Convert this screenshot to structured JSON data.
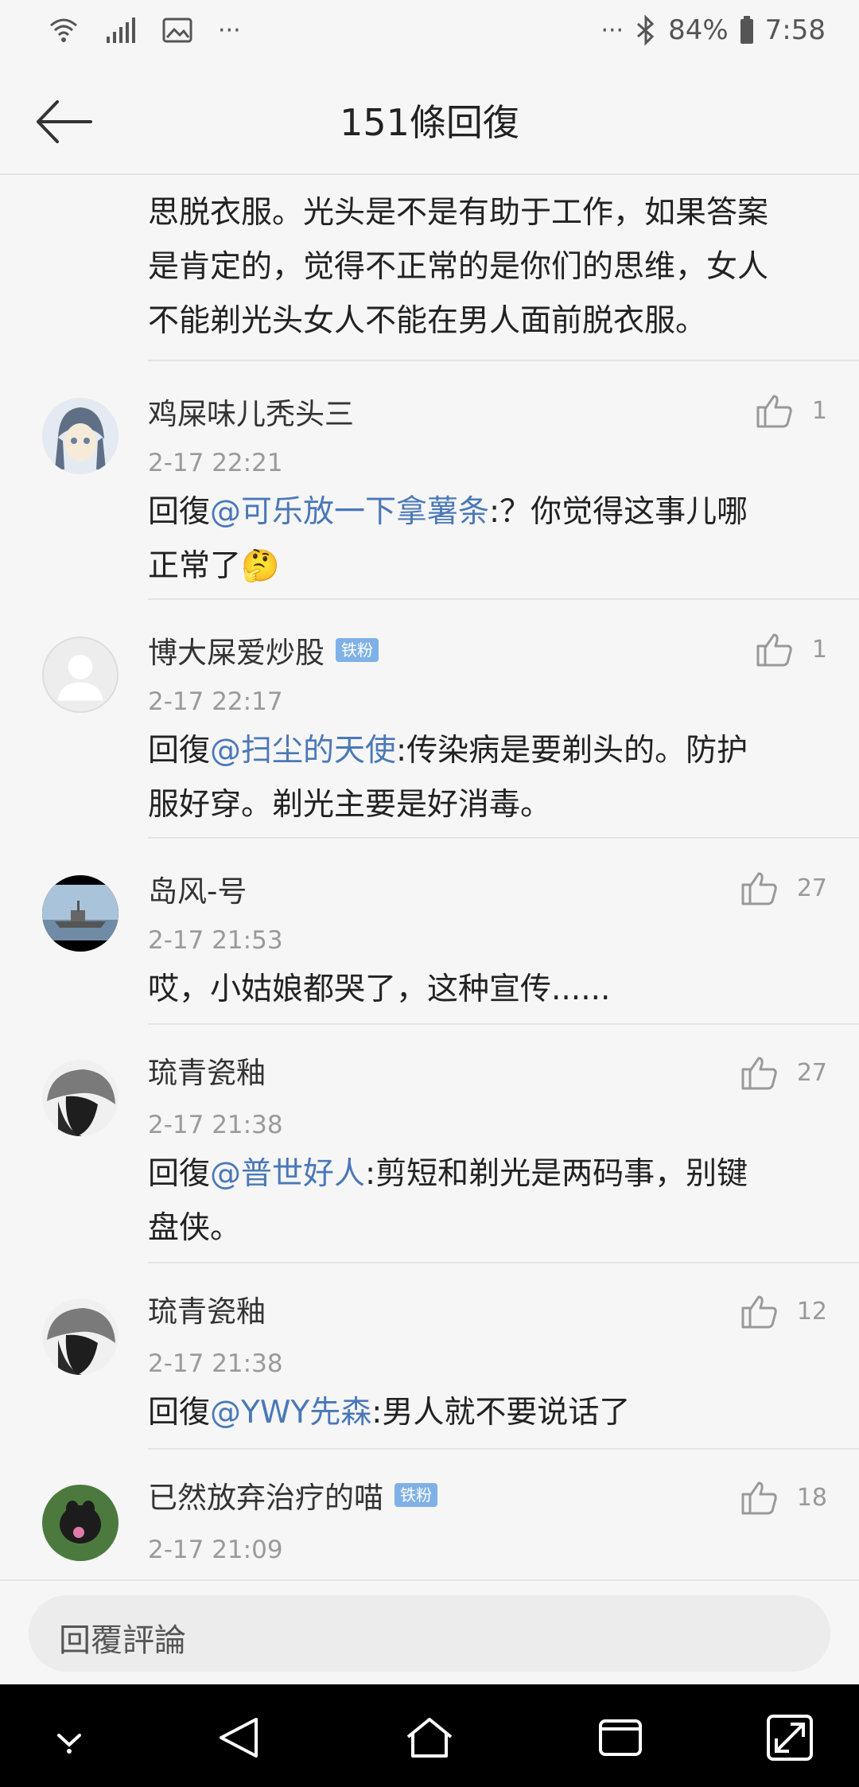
{
  "status_bar": {
    "battery": "84%",
    "time": "7:58",
    "dots_left": "···",
    "dots_right": "···"
  },
  "header": {
    "title": "151條回復"
  },
  "continued_comment": {
    "lines": [
      "思脱衣服。光头是不是有助于工作，如果答案",
      "是肯定的，觉得不正常的是你们的思维，女人",
      "不能剃光头女人不能在男人面前脱衣服。"
    ]
  },
  "comments": [
    {
      "user": "鸡屎味儿秃头三",
      "badge": "",
      "time": "2-17 22:21",
      "likes": "1",
      "prefix": "回復",
      "mention": "@可乐放一下拿薯条",
      "text": ":？你觉得这事儿哪",
      "text2": "正常了",
      "emoji": "🤔",
      "avatar_color": "#c9d3de"
    },
    {
      "user": "博大屎爱炒股",
      "badge": "铁粉",
      "time": "2-17 22:17",
      "likes": "1",
      "prefix": "回復",
      "mention": "@扫尘的天使",
      "text": ":传染病是要剃头的。防护",
      "text2": "服好穿。剃光主要是好消毒。",
      "avatar_color": "#e8e8e8"
    },
    {
      "user": "岛风-号",
      "badge": "",
      "time": "2-17 21:53",
      "likes": "27",
      "prefix": "",
      "mention": "",
      "text": "哎，小姑娘都哭了，这种宣传......",
      "text2": "",
      "avatar_color": "#8aa5bd"
    },
    {
      "user": "琉青瓷釉",
      "badge": "",
      "time": "2-17 21:38",
      "likes": "27",
      "prefix": "回復",
      "mention": "@普世好人",
      "text": ":剪短和剃光是两码事，别键",
      "text2": "盘侠。",
      "avatar_color": "#6b6b6b"
    },
    {
      "user": "琉青瓷釉",
      "badge": "",
      "time": "2-17 21:38",
      "likes": "12",
      "prefix": "回復",
      "mention": "@YWY先森",
      "text": ":男人就不要说话了",
      "text2": "",
      "avatar_color": "#6b6b6b"
    },
    {
      "user": "已然放弃治疗的喵",
      "badge": "铁粉",
      "time": "2-17 21:09",
      "likes": "18",
      "prefix": "",
      "mention": "",
      "text": "",
      "text2": "",
      "avatar_color": "#3f6a3a"
    }
  ],
  "reply_bar": {
    "placeholder": "回覆評論"
  },
  "icons": {
    "wifi": "wifi-icon",
    "signal": "signal-icon",
    "gallery": "image-icon",
    "bluetooth": "bluetooth-icon",
    "battery": "battery-icon",
    "back": "back-arrow-icon",
    "like": "thumbs-up-icon",
    "nav_down": "chevron-down-icon",
    "nav_back": "triangle-back-icon",
    "nav_home": "home-icon",
    "nav_recent": "recent-apps-icon",
    "nav_rotate": "rotate-icon"
  }
}
